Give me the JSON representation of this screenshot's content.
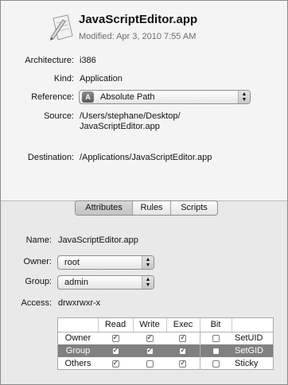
{
  "app": {
    "name": "JavaScriptEditor.app",
    "modified": "Modified:  Apr 3, 2010 7:55 AM"
  },
  "info": {
    "architecture_label": "Architecture:",
    "architecture_value": "i386",
    "kind_label": "Kind:",
    "kind_value": "Application",
    "reference_label": "Reference:",
    "reference_badge": "A",
    "reference_value": "Absolute Path",
    "source_label": "Source:",
    "source_line1": "/Users/stephane/Desktop/",
    "source_line2": "JavaScriptEditor.app",
    "destination_label": "Destination:",
    "destination_value": "/Applications/JavaScriptEditor.app"
  },
  "tabs": [
    {
      "label": "Attributes"
    },
    {
      "label": "Rules"
    },
    {
      "label": "Scripts"
    }
  ],
  "attributes": {
    "name_label": "Name:",
    "name_value": "JavaScriptEditor.app",
    "owner_label": "Owner:",
    "owner_value": "root",
    "group_label": "Group:",
    "group_value": "admin",
    "access_label": "Access:",
    "access_value": "drwxrwxr-x"
  },
  "permissions": {
    "headers": [
      "",
      "Read",
      "Write",
      "Exec",
      "Bit",
      ""
    ],
    "rows": [
      {
        "name": "Owner",
        "read": true,
        "write": true,
        "exec": true,
        "bit": false,
        "flag": "SetUID"
      },
      {
        "name": "Group",
        "read": true,
        "write": true,
        "exec": true,
        "bit": false,
        "flag": "SetGID"
      },
      {
        "name": "Others",
        "read": true,
        "write": false,
        "exec": true,
        "bit": false,
        "flag": "Sticky"
      }
    ]
  },
  "icons": {
    "app_icon": "pencil-ruler-icon",
    "popup_arrows": "updown-arrows-icon"
  },
  "colors": {
    "selected_row": "#808080"
  }
}
